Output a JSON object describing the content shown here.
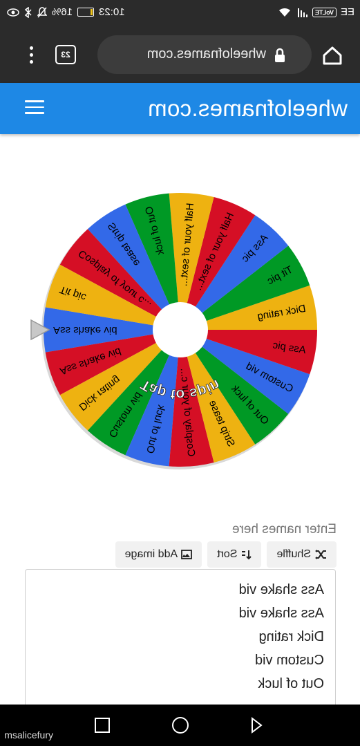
{
  "status_bar": {
    "time": "10:23",
    "battery_percent": "16%",
    "battery_level": 0.16,
    "carrier_badge": "VoLTE",
    "carrier": "EE"
  },
  "browser": {
    "url": "wheelofnames.com",
    "tab_count": "23"
  },
  "app": {
    "title": "wheelofnames.com"
  },
  "wheel": {
    "center_text": "Tap to spin",
    "colors": [
      "#3369e8",
      "#d50f25",
      "#eeb211",
      "#009925"
    ],
    "segments": [
      "Ass shake vid",
      "Ass shake vid",
      "Dick rating",
      "Custom vid",
      "Out of luck",
      "Cosplay of your c...",
      "Strip tease",
      "Out of luck",
      "Custom vid",
      "Ass pic",
      "Dick rating",
      "Tit pic",
      "Ass pic",
      "Half your of sext...",
      "Half your of sext...",
      "Out of luck",
      "Strip tease",
      "Cosplay of your c...",
      "Tit pic"
    ]
  },
  "entries": {
    "label": "Enter names here",
    "shuffle_label": "Shuffle",
    "sort_label": "Sort",
    "add_image_label": "Add image",
    "names": [
      "Ass shake vid",
      "Ass shake vid",
      "Dick rating",
      "Custom vid",
      "Out of luck"
    ]
  },
  "watermark": "msalicefury"
}
